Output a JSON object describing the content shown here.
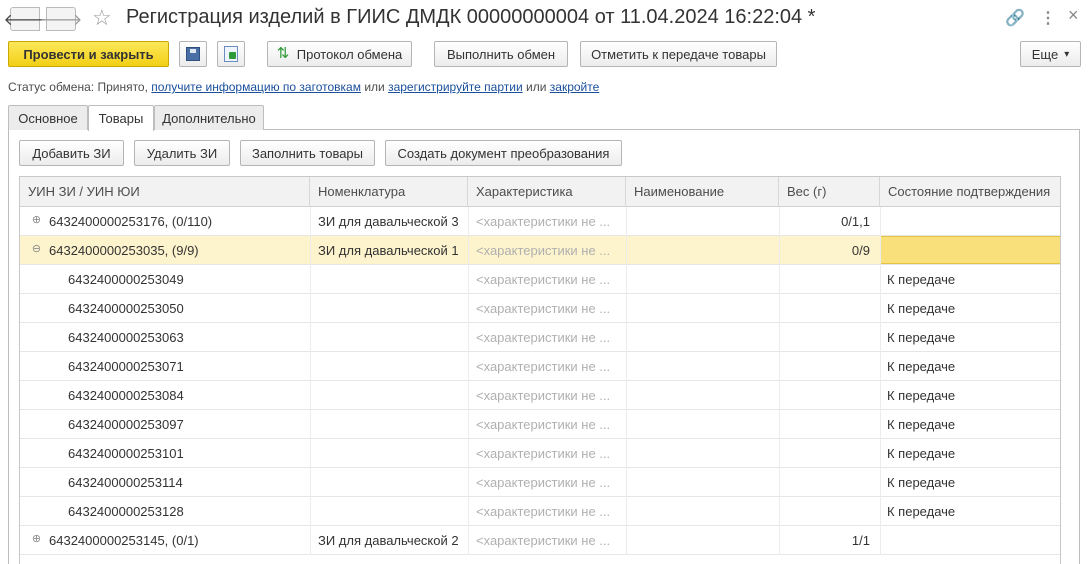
{
  "window": {
    "title": "Регистрация изделий в ГИИС ДМДК 00000000004 от 11.04.2024 16:22:04 *",
    "back_glyph": "🡐",
    "forward_glyph": "🡒",
    "favorite_glyph": "☆",
    "link_glyph": "🔗",
    "more_glyph": "⋮",
    "close_glyph": "×",
    "icons": [
      "back-arrow-icon",
      "forward-arrow-icon",
      "favorite-star-icon",
      "link-icon",
      "more-icon",
      "close-icon"
    ]
  },
  "toolbar": {
    "post_close_label": "Провести и закрыть",
    "protocol_label": "Протокол обмена",
    "exchange_label": "Выполнить обмен",
    "mark_label": "Отметить к передаче товары",
    "more_label": "Еще",
    "more_arrow": "▾",
    "icons": [
      "save-icon",
      "post-document-icon",
      "exchange-protocol-icon"
    ]
  },
  "status": {
    "prefix": "Статус обмена: Принято,",
    "link1": "получите информацию по заготовкам",
    "or1": "или",
    "link2": "зарегистрируйте партии",
    "or2": "или",
    "link3": "закройте"
  },
  "tabs": [
    {
      "label": "Основное"
    },
    {
      "label": "Товары"
    },
    {
      "label": "Дополнительно"
    }
  ],
  "active_tab": "Товары",
  "grid_toolbar": {
    "add_label": "Добавить ЗИ",
    "delete_label": "Удалить ЗИ",
    "fill_label": "Заполнить товары",
    "create_label": "Создать документ преобразования"
  },
  "table": {
    "columns": [
      "УИН ЗИ / УИН ЮИ",
      "Номенклатура",
      "Характеристика",
      "Наименование",
      "Вес (г)",
      "Состояние подтверждения"
    ],
    "expand_glyph": "⊕",
    "collapse_glyph": "⊖",
    "rows": [
      {
        "uin": "6432400000253176, (0/110)",
        "nomenclature": "ЗИ для давальческой 3",
        "characteristic": "<характеристики не ...",
        "name": "",
        "weight": "0/1,1",
        "status": "",
        "level": 0,
        "expander": "plus"
      },
      {
        "uin": "6432400000253035, (9/9)",
        "nomenclature": "ЗИ для давальческой 1",
        "characteristic": "<характеристики не ...",
        "name": "",
        "weight": "0/9",
        "status": "",
        "level": 0,
        "expander": "minus",
        "selected": true
      },
      {
        "uin": "6432400000253049",
        "nomenclature": "",
        "characteristic": "<характеристики не ...",
        "name": "",
        "weight": "",
        "status": "К передаче",
        "level": 1
      },
      {
        "uin": "6432400000253050",
        "nomenclature": "",
        "characteristic": "<характеристики не ...",
        "name": "",
        "weight": "",
        "status": "К передаче",
        "level": 1
      },
      {
        "uin": "6432400000253063",
        "nomenclature": "",
        "characteristic": "<характеристики не ...",
        "name": "",
        "weight": "",
        "status": "К передаче",
        "level": 1
      },
      {
        "uin": "6432400000253071",
        "nomenclature": "",
        "characteristic": "<характеристики не ...",
        "name": "",
        "weight": "",
        "status": "К передаче",
        "level": 1
      },
      {
        "uin": "6432400000253084",
        "nomenclature": "",
        "characteristic": "<характеристики не ...",
        "name": "",
        "weight": "",
        "status": "К передаче",
        "level": 1
      },
      {
        "uin": "6432400000253097",
        "nomenclature": "",
        "characteristic": "<характеристики не ...",
        "name": "",
        "weight": "",
        "status": "К передаче",
        "level": 1
      },
      {
        "uin": "6432400000253101",
        "nomenclature": "",
        "characteristic": "<характеристики не ...",
        "name": "",
        "weight": "",
        "status": "К передаче",
        "level": 1
      },
      {
        "uin": "6432400000253114",
        "nomenclature": "",
        "characteristic": "<характеристики не ...",
        "name": "",
        "weight": "",
        "status": "К передаче",
        "level": 1
      },
      {
        "uin": "6432400000253128",
        "nomenclature": "",
        "characteristic": "<характеристики не ...",
        "name": "",
        "weight": "",
        "status": "К передаче",
        "level": 1
      },
      {
        "uin": "6432400000253145, (0/1)",
        "nomenclature": "ЗИ для давальческой 2",
        "characteristic": "<характеристики не ...",
        "name": "",
        "weight": "1/1",
        "status": "",
        "level": 0,
        "expander": "plus"
      }
    ]
  },
  "colors": {
    "primary_button": "#f2cf16",
    "selected_row": "#fdf3cc",
    "active_cell": "#f9e07a",
    "link": "#1a4f9c"
  }
}
